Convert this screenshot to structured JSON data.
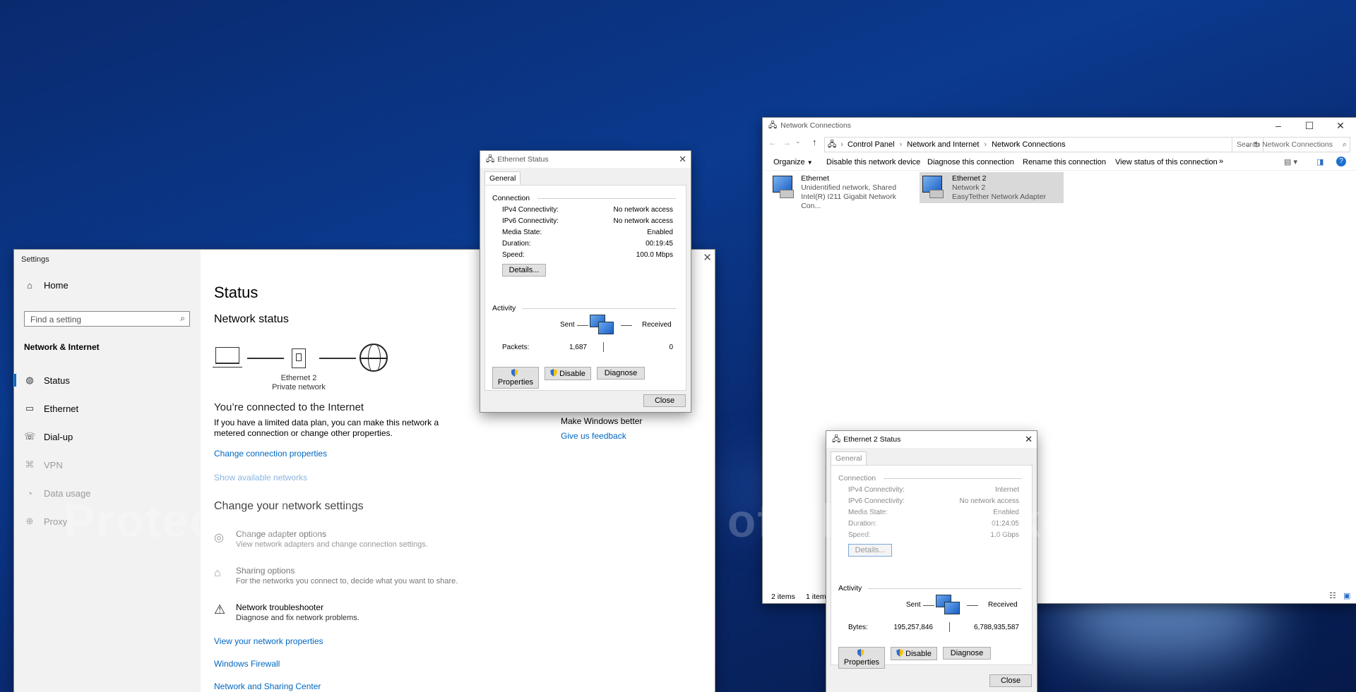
{
  "settings": {
    "title": "Settings",
    "home": "Home",
    "search_placeholder": "Find a setting",
    "section": "Network & Internet",
    "nav": [
      {
        "label": "Status",
        "icon": "globe-icon"
      },
      {
        "label": "Ethernet",
        "icon": "ethernet-icon"
      },
      {
        "label": "Dial-up",
        "icon": "dialup-icon"
      },
      {
        "label": "VPN",
        "icon": "vpn-icon"
      },
      {
        "label": "Data usage",
        "icon": "data-usage-icon"
      },
      {
        "label": "Proxy",
        "icon": "proxy-icon"
      }
    ],
    "heading": "Status",
    "network_status": "Network status",
    "adapter_name": "Ethernet 2",
    "adapter_type": "Private network",
    "connected": "You’re connected to the Internet",
    "data_plan_text": "If you have a limited data plan, you can make this network a metered connection or change other properties.",
    "change_props": "Change connection properties",
    "show_networks": "Show available networks",
    "change_settings": "Change your network settings",
    "options": [
      {
        "title": "Change adapter options",
        "desc": "View network adapters and change connection settings.",
        "icon": "adapter-icon"
      },
      {
        "title": "Sharing options",
        "desc": "For the networks you connect to, decide what you want to share.",
        "icon": "sharing-icon"
      },
      {
        "title": "Network troubleshooter",
        "desc": "Diagnose and fix network problems.",
        "icon": "warning-icon"
      }
    ],
    "links": [
      "View your network properties",
      "Windows Firewall",
      "Network and Sharing Center"
    ],
    "feedback_title": "Make Windows better",
    "feedback_link": "Give us feedback"
  },
  "eth1": {
    "title": "Ethernet Status",
    "tab": "General",
    "connection": "Connection",
    "rows": [
      {
        "k": "IPv4 Connectivity:",
        "v": "No network access"
      },
      {
        "k": "IPv6 Connectivity:",
        "v": "No network access"
      },
      {
        "k": "Media State:",
        "v": "Enabled"
      },
      {
        "k": "Duration:",
        "v": "00:19:45"
      },
      {
        "k": "Speed:",
        "v": "100.0 Mbps"
      }
    ],
    "details": "Details...",
    "activity": "Activity",
    "sent": "Sent",
    "received": "Received",
    "metric": "Packets:",
    "sent_value": "1,687",
    "received_value": "0",
    "properties": "Properties",
    "disable": "Disable",
    "diagnose": "Diagnose",
    "close": "Close"
  },
  "eth2": {
    "title": "Ethernet 2 Status",
    "tab": "General",
    "connection": "Connection",
    "rows": [
      {
        "k": "IPv4 Connectivity:",
        "v": "Internet"
      },
      {
        "k": "IPv6 Connectivity:",
        "v": "No network access"
      },
      {
        "k": "Media State:",
        "v": "Enabled"
      },
      {
        "k": "Duration:",
        "v": "01:24:05"
      },
      {
        "k": "Speed:",
        "v": "1.0 Gbps"
      }
    ],
    "details": "Details...",
    "activity": "Activity",
    "sent": "Sent",
    "received": "Received",
    "metric": "Bytes:",
    "sent_value": "195,257,846",
    "received_value": "6,788,935,587",
    "properties": "Properties",
    "disable": "Disable",
    "diagnose": "Diagnose",
    "close": "Close"
  },
  "netconn": {
    "title": "Network Connections",
    "breadcrumb": [
      "Control Panel",
      "Network and Internet",
      "Network Connections"
    ],
    "search_placeholder": "Search Network Connections",
    "commands": [
      "Organize",
      "Disable this network device",
      "Diagnose this connection",
      "Rename this connection",
      "View status of this connection",
      "»"
    ],
    "items": [
      {
        "name": "Ethernet",
        "line2": "Unidentified network, Shared",
        "line3": "Intel(R) I211 Gigabit Network Con..."
      },
      {
        "name": "Ethernet 2",
        "line2": "Network 2",
        "line3": "EasyTether Network Adapter"
      }
    ],
    "status_count": "2 items",
    "status_selected": "1 item"
  },
  "watermark": "Protected with Free version of Photobucket"
}
